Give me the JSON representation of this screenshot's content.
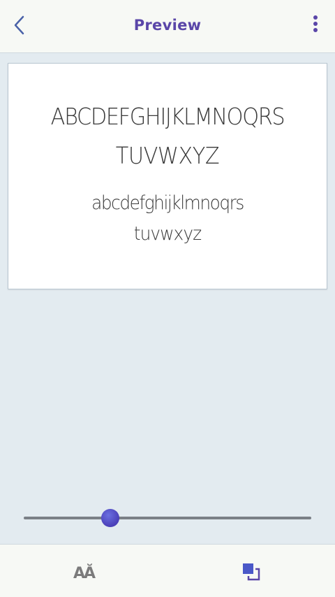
{
  "header": {
    "title": "Preview",
    "back_icon": "chevron-left-icon",
    "menu_icon": "more-vertical-icon"
  },
  "preview": {
    "uppercase_line1": "ABCDEFGHIJKLMNOQRS",
    "uppercase_line2": "TUVWXYZ",
    "lowercase_line1": "abcdefghijklmnoqrs",
    "lowercase_line2": "tuvwxyz"
  },
  "size_slider": {
    "value_fraction": 0.3
  },
  "bottom_bar": {
    "font_size_label": "AĂ",
    "copy_icon": "layers-icon"
  },
  "colors": {
    "accent": "#5a46a8",
    "thumb": "#4a3fb8",
    "background": "#e3ebf0"
  }
}
